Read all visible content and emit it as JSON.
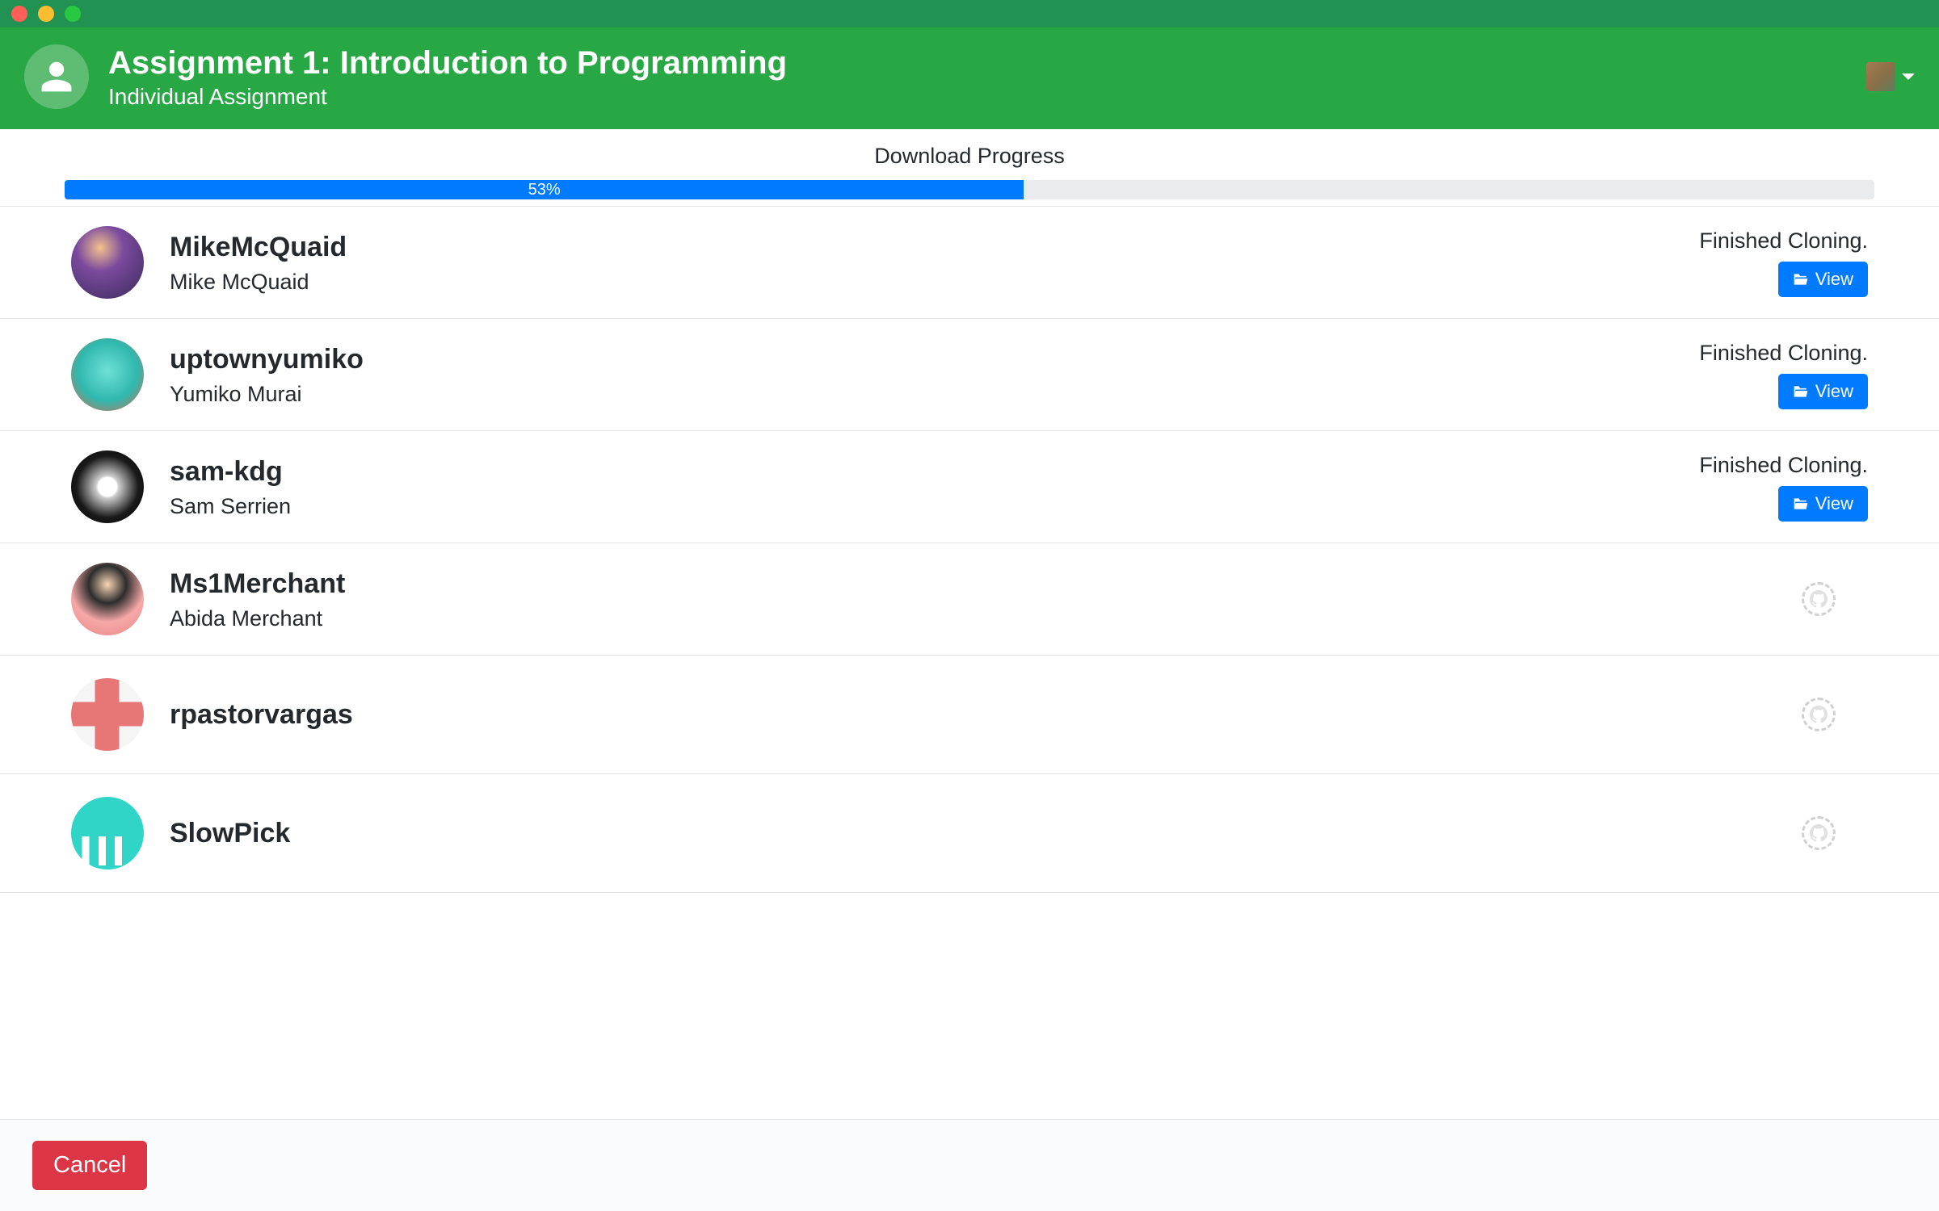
{
  "header": {
    "title": "Assignment 1: Introduction to Programming",
    "subtitle": "Individual Assignment"
  },
  "progress": {
    "label": "Download Progress",
    "percent_text": "53%",
    "percent_value": 53
  },
  "students": [
    {
      "username": "MikeMcQuaid",
      "fullname": "Mike McQuaid",
      "status": "Finished Cloning.",
      "done": true
    },
    {
      "username": "uptownyumiko",
      "fullname": "Yumiko Murai",
      "status": "Finished Cloning.",
      "done": true
    },
    {
      "username": "sam-kdg",
      "fullname": "Sam Serrien",
      "status": "Finished Cloning.",
      "done": true
    },
    {
      "username": "Ms1Merchant",
      "fullname": "Abida Merchant",
      "status": "",
      "done": false
    },
    {
      "username": "rpastorvargas",
      "fullname": "",
      "status": "",
      "done": false
    },
    {
      "username": "SlowPick",
      "fullname": "",
      "status": "",
      "done": false
    }
  ],
  "buttons": {
    "view": "View",
    "cancel": "Cancel"
  }
}
